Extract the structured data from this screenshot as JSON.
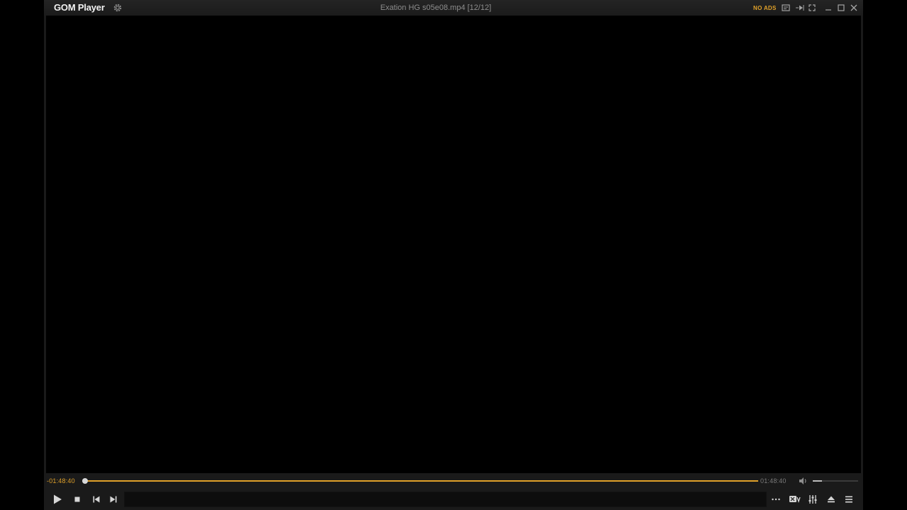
{
  "window": {
    "app_name": "GOM Player",
    "file_title": "Exation HG s05e08.mp4  [12/12]",
    "badge": "NO ADS"
  },
  "colors": {
    "accent": "#e0a12a",
    "window_bg": "#1a1a1a",
    "video_bg": "#000000"
  },
  "titlebar_icons": [
    "settings-icon",
    "subtitle-toggle-icon",
    "playlist-icon",
    "mini-mode-icon",
    "minimize-icon",
    "maximize-icon",
    "close-icon"
  ],
  "seek": {
    "elapsed": "-01:48:40",
    "total": "01:48:40",
    "progress": 0.0
  },
  "volume": {
    "level": 0.2
  },
  "controls": {
    "left": [
      "play-icon",
      "stop-icon",
      "previous-icon",
      "next-icon"
    ],
    "right": [
      "more-icon",
      "360-vr-icon",
      "equalizer-icon",
      "eject-icon",
      "menu-icon"
    ]
  }
}
